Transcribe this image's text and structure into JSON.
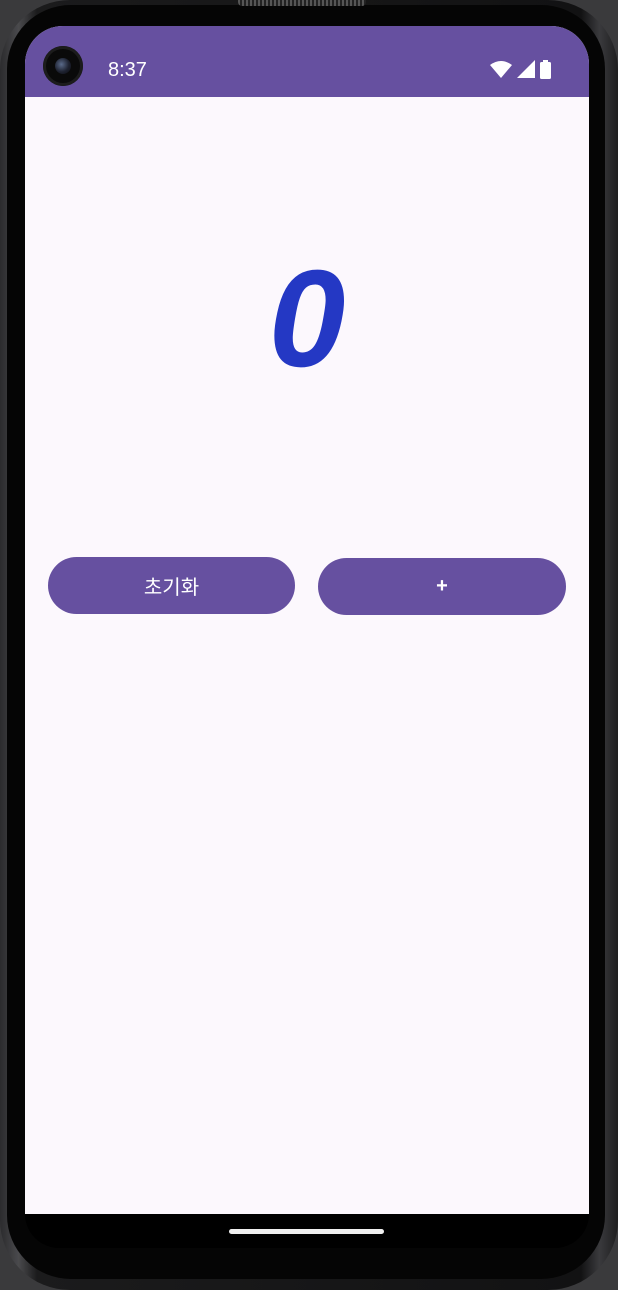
{
  "status_bar": {
    "time": "8:37",
    "background_color": "#6650a0",
    "icons": [
      "wifi-icon",
      "cellular-signal-icon",
      "battery-icon"
    ]
  },
  "counter": {
    "value": "0",
    "color": "#2438c4"
  },
  "buttons": {
    "reset_label": "초기화",
    "plus_label": "+",
    "color": "#6650a0"
  },
  "screen": {
    "background_color": "#fcf8fd"
  }
}
